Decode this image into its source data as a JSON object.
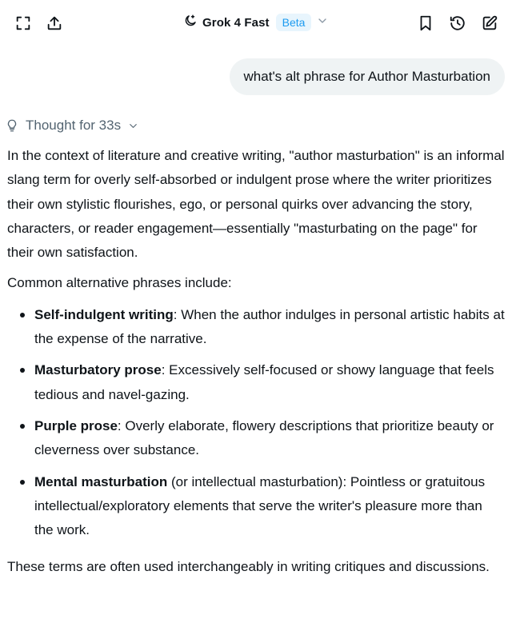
{
  "header": {
    "model_name": "Grok 4 Fast",
    "badge": "Beta",
    "icons": {
      "expand": "expand-icon",
      "share": "share-upload-icon",
      "model": "moon-sparkle-icon",
      "dropdown": "chevron-down-icon",
      "bookmark": "bookmark-icon",
      "history": "history-icon",
      "edit": "edit-compose-icon"
    }
  },
  "conversation": {
    "user_message": "what's alt phrase for Author Masturbation",
    "thought_label": "Thought for 33s",
    "intro": "In the context of literature and creative writing, \"author masturbation\" is an informal slang term for overly self-absorbed or indulgent prose where the writer prioritizes their own stylistic flourishes, ego, or personal quirks over advancing the story, characters, or reader engagement—essentially \"masturbating on the page\" for their own satisfaction.",
    "list_intro": "Common alternative phrases include:",
    "items": [
      {
        "term": "Self-indulgent writing",
        "aside": "",
        "desc": ": When the author indulges in personal artistic habits at the expense of the narrative."
      },
      {
        "term": "Masturbatory prose",
        "aside": "",
        "desc": ": Excessively self-focused or showy language that feels tedious and navel-gazing."
      },
      {
        "term": "Purple prose",
        "aside": "",
        "desc": ": Overly elaborate, flowery descriptions that prioritize beauty or cleverness over substance."
      },
      {
        "term": "Mental masturbation",
        "aside": " (or intellectual masturbation)",
        "desc": ": Pointless or gratuitous intellectual/exploratory elements that serve the writer's pleasure more than the work."
      }
    ],
    "closing": "These terms are often used interchangeably in writing critiques and discussions."
  },
  "colors": {
    "text": "#0f1419",
    "muted": "#536471",
    "accent": "#1d9bf0",
    "badge_bg": "#e8f5fd",
    "bubble_bg": "#eff3f4"
  }
}
